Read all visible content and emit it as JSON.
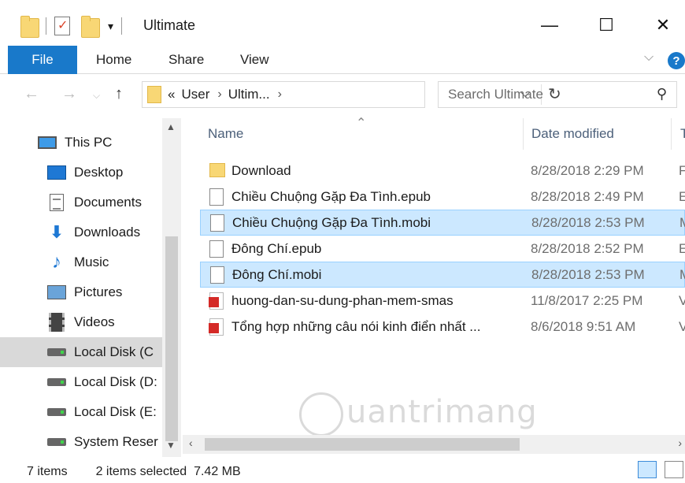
{
  "window": {
    "title": "Ultimate",
    "minimize": "—",
    "maximize": "☐",
    "close": "✕"
  },
  "ribbon": {
    "file": "File",
    "home": "Home",
    "share": "Share",
    "view": "View",
    "help": "?"
  },
  "address": {
    "prefix": "«",
    "crumbs": [
      "User",
      "Ultim..."
    ],
    "search_placeholder": "Search Ultimate"
  },
  "nav": {
    "items": [
      {
        "label": "This PC",
        "icon": "computer-icon"
      },
      {
        "label": "Desktop",
        "icon": "desktop-icon"
      },
      {
        "label": "Documents",
        "icon": "documents-icon"
      },
      {
        "label": "Downloads",
        "icon": "downloads-icon"
      },
      {
        "label": "Music",
        "icon": "music-icon"
      },
      {
        "label": "Pictures",
        "icon": "pictures-icon"
      },
      {
        "label": "Videos",
        "icon": "videos-icon"
      },
      {
        "label": "Local Disk (C",
        "icon": "disk-icon",
        "selected": true
      },
      {
        "label": "Local Disk (D:",
        "icon": "disk-icon"
      },
      {
        "label": "Local Disk (E:",
        "icon": "disk-icon"
      },
      {
        "label": "System Reser",
        "icon": "disk-icon"
      }
    ]
  },
  "columns": {
    "name": "Name",
    "date": "Date modified",
    "type": "T"
  },
  "files": [
    {
      "name": "Download",
      "date": "8/28/2018 2:29 PM",
      "type": "F",
      "icon": "folder-icon",
      "selected": false
    },
    {
      "name": "Chiều Chuộng Gặp Đa Tình.epub",
      "date": "8/28/2018 2:49 PM",
      "type": "E",
      "icon": "file-icon",
      "selected": false
    },
    {
      "name": "Chiều Chuộng Gặp Đa Tình.mobi",
      "date": "8/28/2018 2:53 PM",
      "type": "M",
      "icon": "file-icon",
      "selected": true
    },
    {
      "name": "Đông Chí.epub",
      "date": "8/28/2018 2:52 PM",
      "type": "E",
      "icon": "file-icon",
      "selected": false
    },
    {
      "name": "Đông Chí.mobi",
      "date": "8/28/2018 2:53 PM",
      "type": "M",
      "icon": "file-icon",
      "selected": true
    },
    {
      "name": "huong-dan-su-dung-phan-mem-smas",
      "date": "11/8/2017 2:25 PM",
      "type": "V",
      "icon": "pdf-icon",
      "selected": false
    },
    {
      "name": "Tổng hợp những câu nói kinh điển nhất ...",
      "date": "8/6/2018 9:51 AM",
      "type": "V",
      "icon": "pdf-icon",
      "selected": false
    }
  ],
  "status": {
    "count": "7 items",
    "selection": "2 items selected  7.42 MB"
  },
  "watermark": "uantrimang"
}
